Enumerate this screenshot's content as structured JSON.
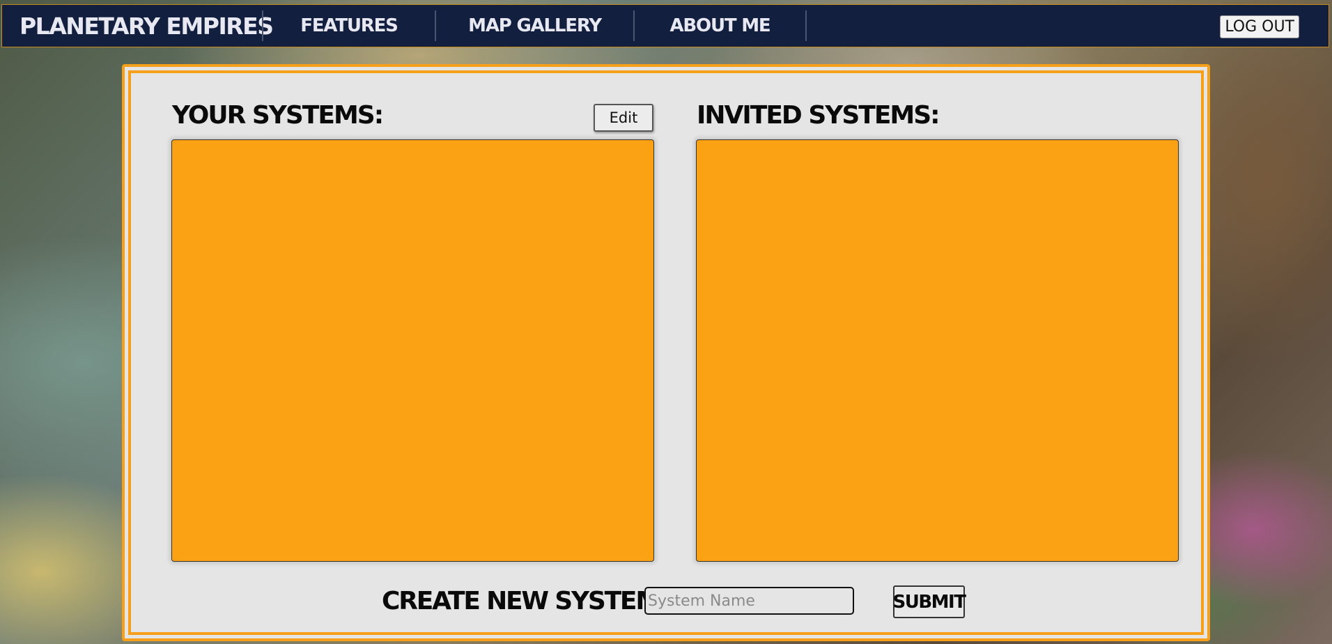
{
  "nav": {
    "brand": "PLANETARY EMPIRES",
    "links": [
      "FEATURES",
      "MAP GALLERY",
      "ABOUT ME"
    ],
    "logout_label": "LOG OUT"
  },
  "panel": {
    "your_systems": {
      "title": "YOUR SYSTEMS:",
      "edit_label": "Edit",
      "items": []
    },
    "invited_systems": {
      "title": "INVITED SYSTEMS:",
      "items": []
    },
    "create": {
      "label": "CREATE NEW SYSTEM:",
      "input_value": "",
      "input_placeholder": "System Name",
      "submit_label": "SUBMIT"
    }
  },
  "colors": {
    "navbar_bg": "#131f3e",
    "accent_orange": "#faa214",
    "panel_bg": "#e5e5e5"
  }
}
